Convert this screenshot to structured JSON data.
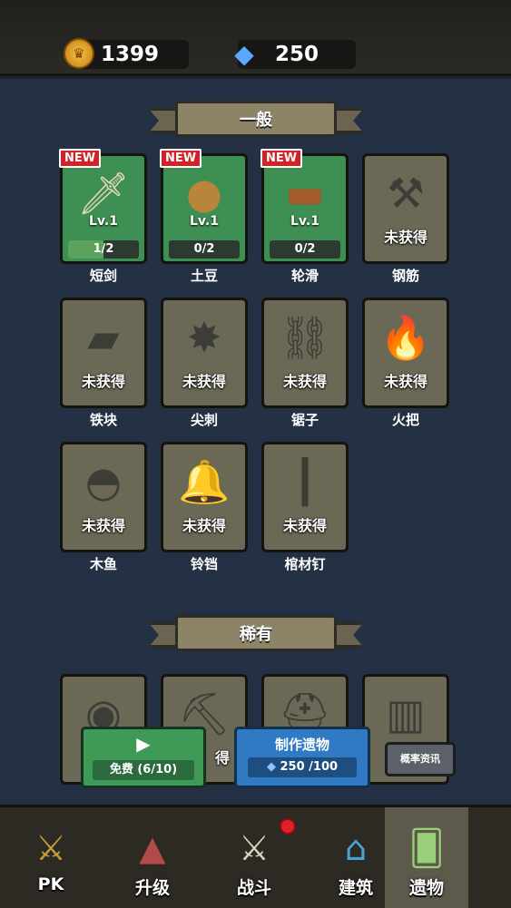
{
  "currency": {
    "coins": "1399",
    "gems": "250",
    "coin_icon": "crown-coin-icon",
    "gem_icon": "diamond-icon"
  },
  "sections": {
    "common_title": "一般",
    "rare_title": "稀有"
  },
  "common_items": [
    {
      "name": "短剑",
      "new_badge": "NEW",
      "level": "Lv.1",
      "progress": "1/2",
      "progress_value": 0.5,
      "icon": "dagger-icon"
    },
    {
      "name": "土豆",
      "new_badge": "NEW",
      "level": "Lv.1",
      "progress": "0/2",
      "progress_value": 0,
      "icon": "potato-icon"
    },
    {
      "name": "轮滑",
      "new_badge": "NEW",
      "level": "Lv.1",
      "progress": "0/2",
      "progress_value": 0,
      "icon": "skateboard-icon"
    },
    {
      "name": "钢筋",
      "state": "未获得",
      "icon": "rebar-icon"
    },
    {
      "name": "铁块",
      "state": "未获得",
      "icon": "iron-block-icon"
    },
    {
      "name": "尖刺",
      "state": "未获得",
      "icon": "spikes-icon"
    },
    {
      "name": "锯子",
      "state": "未获得",
      "icon": "saw-icon"
    },
    {
      "name": "火把",
      "state": "未获得",
      "icon": "torch-icon"
    },
    {
      "name": "木鱼",
      "state": "未获得",
      "icon": "wooden-fish-icon"
    },
    {
      "name": "铃铛",
      "state": "未获得",
      "icon": "bell-icon"
    },
    {
      "name": "棺材钉",
      "state": "未获得",
      "icon": "coffin-nail-icon"
    }
  ],
  "rare_items": [
    {
      "icon": "bandage-icon"
    },
    {
      "state_partial": "得",
      "icon": "pickaxe-icon"
    },
    {
      "icon": "helmet-icon"
    },
    {
      "icon": "barrel-icon"
    }
  ],
  "actions": {
    "free_label": "免费 (6/10)",
    "make_label": "制作遗物",
    "make_cost": "250 /100",
    "rate_label": "概率资讯"
  },
  "nav": {
    "pk": "PK",
    "upgrade": "升级",
    "battle": "战斗",
    "build": "建筑",
    "relics": "遗物"
  }
}
